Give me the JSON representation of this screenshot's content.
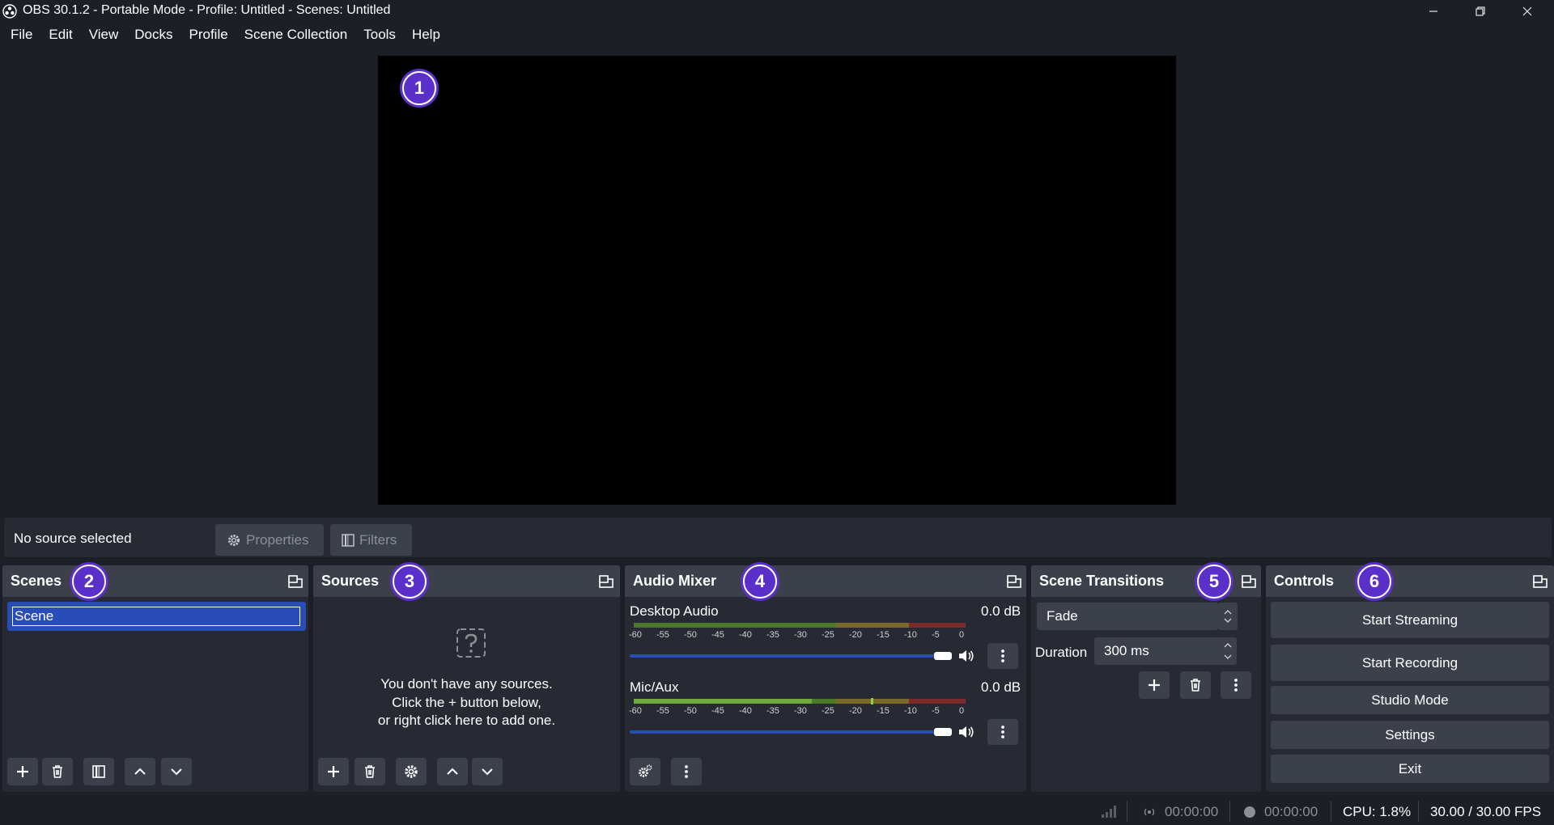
{
  "window": {
    "title": "OBS 30.1.2 - Portable Mode - Profile: Untitled - Scenes: Untitled"
  },
  "menu": [
    "File",
    "Edit",
    "View",
    "Docks",
    "Profile",
    "Scene Collection",
    "Tools",
    "Help"
  ],
  "badges": [
    "1",
    "2",
    "3",
    "4",
    "5",
    "6"
  ],
  "context": {
    "status": "No source selected",
    "properties_label": "Properties",
    "filters_label": "Filters"
  },
  "scenes": {
    "title": "Scenes",
    "items": [
      "Scene"
    ]
  },
  "sources": {
    "title": "Sources",
    "empty_line1": "You don't have any sources.",
    "empty_line2": "Click the + button below,",
    "empty_line3": "or right click here to add one."
  },
  "mixer": {
    "title": "Audio Mixer",
    "channels": [
      {
        "name": "Desktop Audio",
        "db": "0.0 dB",
        "volume": 1.0
      },
      {
        "name": "Mic/Aux",
        "db": "0.0 dB",
        "volume": 1.0
      }
    ],
    "ticks": [
      "-60",
      "-55",
      "-50",
      "-45",
      "-40",
      "-35",
      "-30",
      "-25",
      "-20",
      "-15",
      "-10",
      "-5",
      "0"
    ]
  },
  "transitions": {
    "title": "Scene Transitions",
    "selected": "Fade",
    "duration_label": "Duration",
    "duration_value": "300 ms"
  },
  "controls": {
    "title": "Controls",
    "start_streaming": "Start Streaming",
    "start_recording": "Start Recording",
    "studio_mode": "Studio Mode",
    "settings": "Settings",
    "exit": "Exit"
  },
  "status": {
    "stream_time": "00:00:00",
    "record_time": "00:00:00",
    "cpu": "CPU: 1.8%",
    "fps": "30.00 / 30.00 FPS"
  },
  "colors": {
    "accent": "#284cb8",
    "badge": "#5b2fc9",
    "panel": "#272a33",
    "header": "#3c404b",
    "background": "#1d1f26"
  }
}
